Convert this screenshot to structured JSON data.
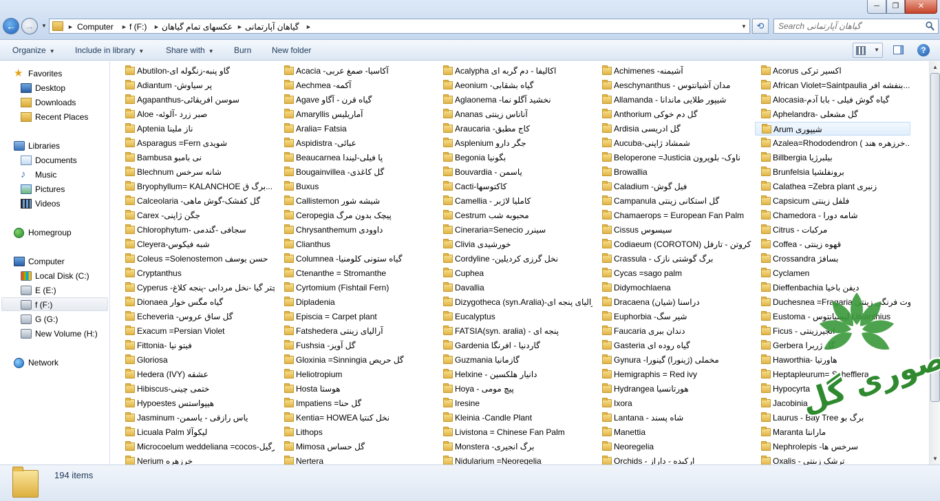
{
  "window": {
    "minimize": "─",
    "maximize": "❐",
    "close": "✕"
  },
  "address": {
    "crumbs": [
      "Computer",
      "f (F:)",
      "عکسهای تمام گیاهان",
      "گیاهان آپارتمانی"
    ]
  },
  "search": {
    "placeholder": "Search گیاهان آپارتمانی"
  },
  "toolbar": {
    "organize": "Organize",
    "include_in_library": "Include in library",
    "share_with": "Share with",
    "burn": "Burn",
    "new_folder": "New folder"
  },
  "nav": {
    "favorites": "Favorites",
    "desktop": "Desktop",
    "downloads": "Downloads",
    "recent_places": "Recent Places",
    "libraries": "Libraries",
    "documents": "Documents",
    "music": "Music",
    "pictures": "Pictures",
    "videos": "Videos",
    "homegroup": "Homegroup",
    "computer": "Computer",
    "local_disk": "Local Disk (C:)",
    "drive_e": "E (E:)",
    "drive_f": "f (F:)",
    "drive_g": "G (G:)",
    "new_volume": "New Volume (H:)",
    "network": "Network"
  },
  "files": {
    "columns": [
      [
        "Abutilon-گاو پنبه-زنگوله ای",
        "Adiantum -پر سیاوش",
        "Agapanthus-سوسن افریقائی",
        "Aloe -صبر زرد -آلوئه",
        "Aptenia ناز ملینا",
        "Asparagus =Fern شویدی",
        "Bambusa نی بامبو",
        "Blechnum شانه سرخس",
        "Bryophyllum= KALANCHOE برگ ق...",
        "Calceolaria -گل کفشک-گوش ماهی",
        "Carex -جگن ژاپنی",
        "Chlorophytum- سجافی -گندمی",
        "Cleyera-شبه فیکوس",
        "Coleus =Solenostemon حسن یوسف",
        "Cryptanthus",
        "Cyperus -پاپیروس-چتر گیا -نخل مردابی -پنجه کلاغ",
        "Dionaea گیاه مگس خوار",
        "Echeveria -گل ساق عروس",
        "Exacum =Persian Violet",
        "Fittonia- فیتو نیا",
        "Gloriosa",
        "Hedera (IVY) عشقه",
        "Hibiscus-ختمی چینی",
        "Hypoestes هیپواستس",
        "Jasminum -یاس رازقی - یاسمن",
        "Licuala Palm لیکوآلا",
        "Microcoelum weddeliana =cocos-نارگیل",
        "Nerium خرزهره"
      ],
      [
        "Acacia -آکاسیا- صمغ عربی",
        "Aechmea -آکمه",
        "Agave گیاه قرن - آگاو",
        "Amaryllis آماریلیس",
        "Aralia= Fatsia",
        "Aspidistra -عبائی",
        "Beaucarnea پا فیلی-لیندا",
        "Bougainvillea -گل کاغذی",
        "Buxus",
        "Callistemon شیشه شور",
        "Ceropegia پیچک بدون مرگ",
        "Chrysanthemum داوودی",
        "Clianthus",
        "Columnea -گیاه ستونی کلومنیا",
        "Ctenanthe = Stromanthe",
        "Cyrtomium (Fishtail Fern)",
        "Dipladenia",
        "Episcia = Carpet plant",
        "Fatshedera آرالیای زینتی",
        "Fushsia -گل آویز",
        "Gloxinia =Sinningia گل حریص",
        "Heliotropium",
        "Hosta هوستا",
        "Impatiens =گل حنا",
        "Kentia= HOWEA نخل کنتیا",
        "Lithops",
        "Mimosa گل حساس",
        "Nertera"
      ],
      [
        "Acalypha اکالیفا - دم گربه ای",
        "Aeonium -گیاه بشقابی",
        "Aglaonema -نخشید آگلو نما",
        "Ananas آناناس زینتی",
        "Araucaria -کاج مطبق",
        "Asplenium جگر دارو",
        "Begonia بگونیا",
        "Bouvardia - یاسمن",
        "Cacti-کاکتوسها",
        "Camellia - کاملیا لاژبر",
        "Cestrum محبوبه شب",
        "Cineraria=Senecio سینرر",
        "Clivia خورشیدی",
        "Cordyline -نخل گرزی کردیلین",
        "Cuphea",
        "Davallia",
        "Dizygotheca (syn.Aralia)-آرالیای پنجه ای",
        "Eucalyptus",
        "FATSIA(syn. aralia) - پنجه ای",
        "Gardenia گاردنیا - افرنگا",
        "Guzmania گازمانیا",
        "Helxine - دانیار هلکسین",
        "Hoya - پیچ مومی",
        "Iresine",
        "Kleinia -Candle Plant",
        "Livistona = Chinese Fan Palm",
        "Monstera -برگ انجیری",
        "Nidularium =Neoregelia"
      ],
      [
        "Achimenes -آشیمنه",
        "Aeschynanthus - مدان آشیانتوس",
        "Allamanda - شیپور طلایی ماندانا",
        "Anthorium گل دم خوکی",
        "Ardisia گل ادریسی",
        "Aucuba-شمشاد ژاپنی",
        "Beloperone =Justicia ناوک- بلوپرون",
        "Browallia",
        "Caladium -فیل گوش",
        "Campanula گل استکانی زینتی",
        "Chamaerops = European Fan Palm",
        "Cissus سیسوس",
        "Codiaeum (COROTON) کروتن - تارفل",
        "Crassula - برگ گوشتی نازک",
        "Cycas =sago palm",
        "Didymochlaena",
        "Dracaena (شیان) دراسنا",
        "Euphorbia -شیر سگ",
        "Faucaria دندان ببری",
        "Gasteria گیاه روده ای",
        "Gynura -مخملی (ژینورا) گینورا",
        "Hemigraphis = Red ivy",
        "Hydrangea هورتانسیا",
        "Ixora",
        "Lantana - شاه پسند",
        "Manettia",
        "Neoregelia",
        "Orchids - ارکیده - داراز"
      ],
      [
        "Acorus اکسیر ترکی",
        "African Violet=Saintpaulia بنفشه افر...",
        "Alocasia-گیاه گوش فیلی - بابا آدم",
        "Aphelandra- گل مشعلی",
        "Arum شیپوری",
        "Azalea=Rhododendron ( خرزهره هند...",
        "Billbergia بیلبرژیا",
        "Brunfelsia برونفلشیا",
        "Calathea =Zebra plant زنبری",
        "Capsicum فلفل زینتی",
        "Chamedora - شامه دورا",
        "Citrus - مرکبات",
        "Coffea - قهوه زینتی",
        "Crossandra بسافژ",
        "Cyclamen",
        "Dieffenbachia دیفن باخیا",
        "Duchesnea =Fragaria توت فرنگی زینتی",
        "Eustoma - لیسیانتوس Lisianthius",
        "Ficus - انجیرزینتی",
        "Gerbera گل ژربرا",
        "Haworthia- هاورتیا",
        "Heptapleurum= Schefflera",
        "Hypocyrta",
        "Jacobinia",
        "Laurus - Bay Tree برگ بو",
        "Maranta مارانتا",
        "Nephrolepis -سرخس ها",
        "Oxalis - ترشک زینتی"
      ]
    ]
  },
  "details": {
    "item_count": "194 items"
  },
  "logo": {
    "text": "منصوری گل"
  }
}
